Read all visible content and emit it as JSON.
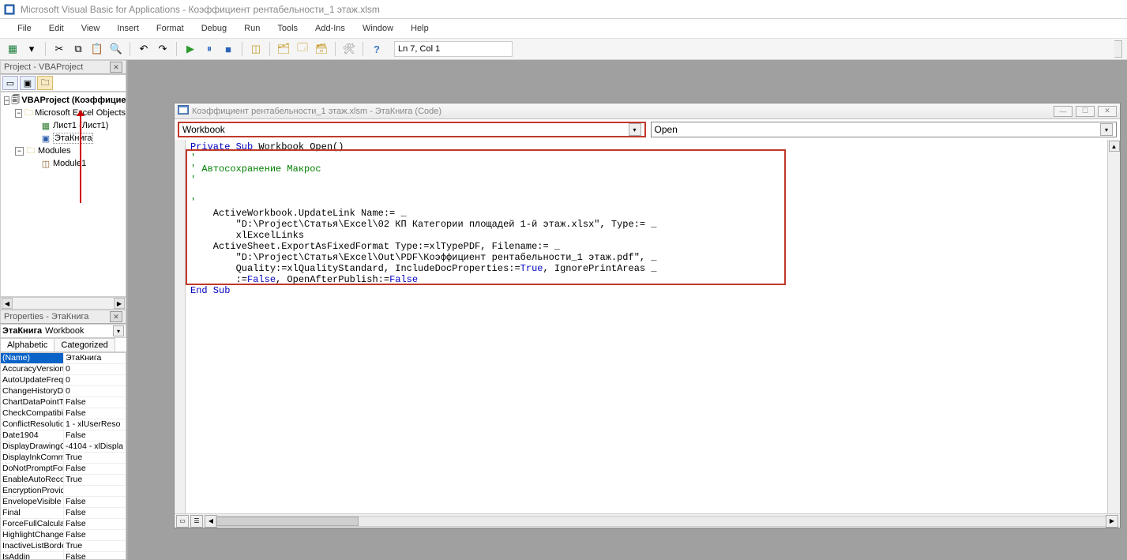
{
  "title": "Microsoft Visual Basic for Applications - Коэффициент рентабельности_1 этаж.xlsm",
  "menus": [
    "File",
    "Edit",
    "View",
    "Insert",
    "Format",
    "Debug",
    "Run",
    "Tools",
    "Add-Ins",
    "Window",
    "Help"
  ],
  "cursor_pos": "Ln 7, Col 1",
  "project_panel_title": "Project - VBAProject",
  "tree": {
    "root": "VBAProject (Коэффицие",
    "group1": "Microsoft Excel Objects",
    "sheet1": "Лист1 (Лист1)",
    "thisbook": "ЭтаКнига",
    "modules": "Modules",
    "module1": "Module1"
  },
  "props_panel_title": "Properties - ЭтаКнига",
  "props_object_bold": "ЭтаКнига",
  "props_object_type": "Workbook",
  "tabs": {
    "alphabetic": "Alphabetic",
    "categorized": "Categorized"
  },
  "props": [
    {
      "n": "(Name)",
      "v": "ЭтаКнига",
      "sel": true
    },
    {
      "n": "AccuracyVersion",
      "v": "0"
    },
    {
      "n": "AutoUpdateFrequency",
      "v": "0"
    },
    {
      "n": "ChangeHistoryDuration",
      "v": "0"
    },
    {
      "n": "ChartDataPointTrack",
      "v": "False"
    },
    {
      "n": "CheckCompatibility",
      "v": "False"
    },
    {
      "n": "ConflictResolution",
      "v": "1 - xlUserReso"
    },
    {
      "n": "Date1904",
      "v": "False"
    },
    {
      "n": "DisplayDrawingObjects",
      "v": "-4104 - xlDispla"
    },
    {
      "n": "DisplayInkComments",
      "v": "True"
    },
    {
      "n": "DoNotPromptForConvert",
      "v": "False"
    },
    {
      "n": "EnableAutoRecover",
      "v": "True"
    },
    {
      "n": "EncryptionProvider",
      "v": ""
    },
    {
      "n": "EnvelopeVisible",
      "v": "False"
    },
    {
      "n": "Final",
      "v": "False"
    },
    {
      "n": "ForceFullCalculation",
      "v": "False"
    },
    {
      "n": "HighlightChangesOnScreen",
      "v": "False"
    },
    {
      "n": "InactiveListBorderVisible",
      "v": "True"
    },
    {
      "n": "IsAddin",
      "v": "False"
    }
  ],
  "code_window_title": "Коэффициент рентабельности_1 этаж.xlsm - ЭтаКнига (Code)",
  "dropdown_object": "Workbook",
  "dropdown_proc": "Open",
  "code": {
    "l1a": "Private Sub",
    "l1b": " Workbook_Open()",
    "l2": "'",
    "l3": "' Автосохранение Макрос",
    "l4": "'",
    "l5": "",
    "l6": "'",
    "l7": "    ActiveWorkbook.UpdateLink Name:= _",
    "l8": "        \"D:\\Project\\Статья\\Excel\\02 КП Категории площадей 1-й этаж.xlsx\", Type:= _",
    "l9": "        xlExcelLinks",
    "l10": "    ActiveSheet.ExportAsFixedFormat Type:=xlTypePDF, Filename:= _",
    "l11": "        \"D:\\Project\\Статья\\Excel\\Out\\PDF\\Коэффициент рентабельности_1 этаж.pdf\", _",
    "l12a": "        Quality:=xlQualityStandard, IncludeDocProperties:=",
    "l12b": "True",
    "l12c": ", IgnorePrintAreas _",
    "l13a": "        :=",
    "l13b": "False",
    "l13c": ", OpenAfterPublish:=",
    "l13d": "False",
    "l14": "End Sub"
  }
}
